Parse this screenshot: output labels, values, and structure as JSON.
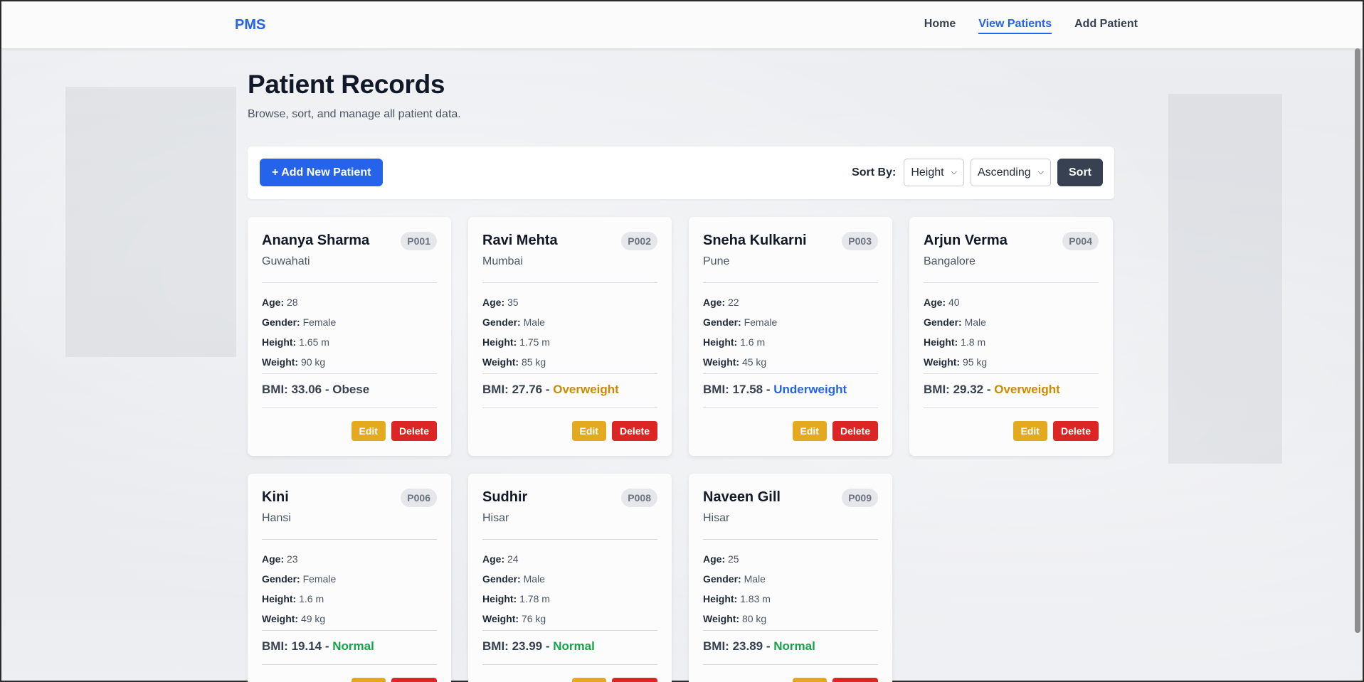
{
  "nav": {
    "brand": "PMS",
    "links": [
      "Home",
      "View Patients",
      "Add Patient"
    ],
    "active": "View Patients"
  },
  "header": {
    "title": "Patient Records",
    "subtitle": "Browse, sort, and manage all patient data."
  },
  "toolbar": {
    "add_label": "+ Add New Patient",
    "sort_by_label": "Sort By:",
    "sort_field": "Height",
    "sort_order": "Ascending",
    "sort_button": "Sort"
  },
  "labels": {
    "age": "Age:",
    "gender": "Gender:",
    "height": "Height:",
    "weight": "Weight:",
    "bmi_prefix": "BMI:",
    "edit": "Edit",
    "delete": "Delete"
  },
  "patients": [
    {
      "name": "Ananya Sharma",
      "id": "P001",
      "city": "Guwahati",
      "age": "28",
      "gender": "Female",
      "height": "1.65 m",
      "weight": "90 kg",
      "bmi": "33.06",
      "category": "Obese"
    },
    {
      "name": "Ravi Mehta",
      "id": "P002",
      "city": "Mumbai",
      "age": "35",
      "gender": "Male",
      "height": "1.75 m",
      "weight": "85 kg",
      "bmi": "27.76",
      "category": "Overweight"
    },
    {
      "name": "Sneha Kulkarni",
      "id": "P003",
      "city": "Pune",
      "age": "22",
      "gender": "Female",
      "height": "1.6 m",
      "weight": "45 kg",
      "bmi": "17.58",
      "category": "Underweight"
    },
    {
      "name": "Arjun Verma",
      "id": "P004",
      "city": "Bangalore",
      "age": "40",
      "gender": "Male",
      "height": "1.8 m",
      "weight": "95 kg",
      "bmi": "29.32",
      "category": "Overweight"
    },
    {
      "name": "Kini",
      "id": "P006",
      "city": "Hansi",
      "age": "23",
      "gender": "Female",
      "height": "1.6 m",
      "weight": "49 kg",
      "bmi": "19.14",
      "category": "Normal"
    },
    {
      "name": "Sudhir",
      "id": "P008",
      "city": "Hisar",
      "age": "24",
      "gender": "Male",
      "height": "1.78 m",
      "weight": "76 kg",
      "bmi": "23.99",
      "category": "Normal"
    },
    {
      "name": "Naveen Gill",
      "id": "P009",
      "city": "Hisar",
      "age": "25",
      "gender": "Male",
      "height": "1.83 m",
      "weight": "80 kg",
      "bmi": "23.89",
      "category": "Normal"
    }
  ],
  "colors": {
    "accent": "#2563eb",
    "overweight": "#ca8a04",
    "underweight": "#2563eb",
    "normal": "#16a34a",
    "edit": "#e3aa1f",
    "delete": "#dc2626"
  }
}
